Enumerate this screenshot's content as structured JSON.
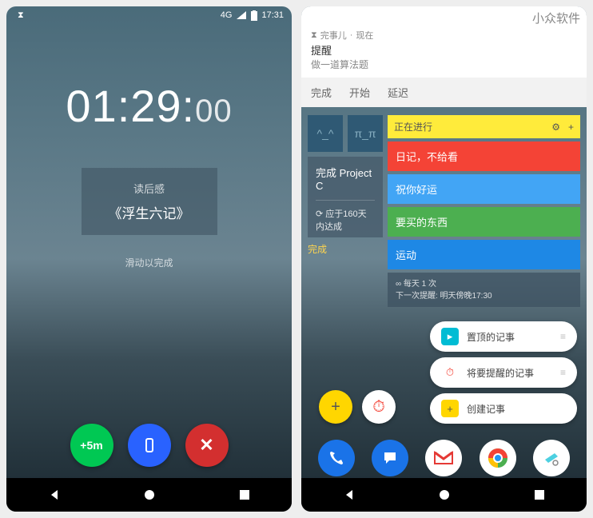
{
  "watermark": "小众软件",
  "phone1": {
    "status": {
      "network": "4G",
      "time": "17:31"
    },
    "timer": {
      "h": "01",
      "m": "29",
      "s": "00"
    },
    "task": {
      "label": "读后感",
      "name": "《浮生六记》"
    },
    "swipe_hint": "滑动以完成",
    "actions": {
      "add5": "+5m"
    }
  },
  "phone2": {
    "notif": {
      "app": "完事儿",
      "when": "现在",
      "title": "提醒",
      "body": "做一道算法题"
    },
    "notif_actions": [
      "完成",
      "开始",
      "延迟"
    ],
    "moods": [
      "^_^",
      "π_π"
    ],
    "project": {
      "title": "完成 Project C",
      "goal": "应于160天内达成",
      "done": "完成"
    },
    "list_header": "正在进行",
    "list_items": [
      {
        "text": "日记，不给看",
        "cls": "li-red"
      },
      {
        "text": "祝你好运",
        "cls": "li-blue"
      },
      {
        "text": "要买的东西",
        "cls": "li-green"
      },
      {
        "text": "运动",
        "cls": "li-sport"
      }
    ],
    "list_footer": {
      "freq": "∞ 每天 1 次",
      "next": "下一次提醒: 明天傍晚17:30"
    },
    "pills": [
      {
        "text": "置顶的记事",
        "bg": "#00bcd4"
      },
      {
        "text": "将要提醒的记事",
        "bg": "#f44336"
      },
      {
        "text": "创建记事",
        "bg": "#ffd600"
      }
    ]
  }
}
